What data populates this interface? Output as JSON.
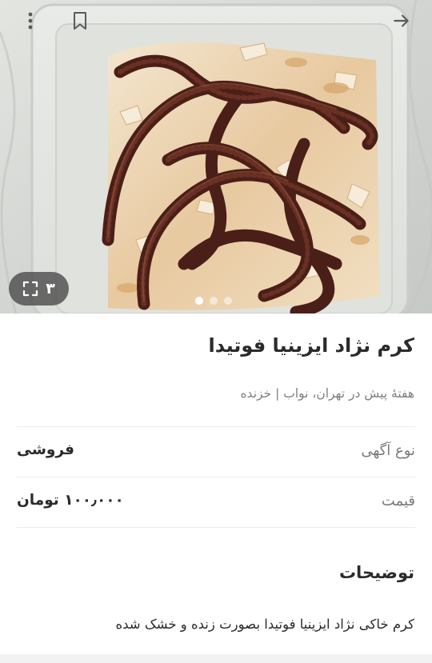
{
  "gallery": {
    "photo_count": "۳",
    "dot_count": 3,
    "active_dot": 0
  },
  "topbar": {
    "back_icon": "arrow-right-icon",
    "bookmark_icon": "bookmark-icon",
    "more_icon": "more-vertical-icon"
  },
  "listing": {
    "title": "کرم نژاد ایزینیا فوتیدا",
    "subtitle": "هفتهٔ پیش در تهران، نواب | خزنده",
    "details": {
      "type_label": "نوع آگهی",
      "type_value": "فروشی",
      "price_label": "قیمت",
      "price_value": "۱۰۰٫۰۰۰ تومان"
    },
    "description_title": "توضیحات",
    "description": "کرم خاکی نژاد ایزینیا فوتیدا بصورت زنده و خشک شده"
  },
  "colors": {
    "text_primary": "#2b2b2b",
    "text_secondary": "#808080",
    "divider": "#ececec",
    "worm": "#4a1f17"
  }
}
